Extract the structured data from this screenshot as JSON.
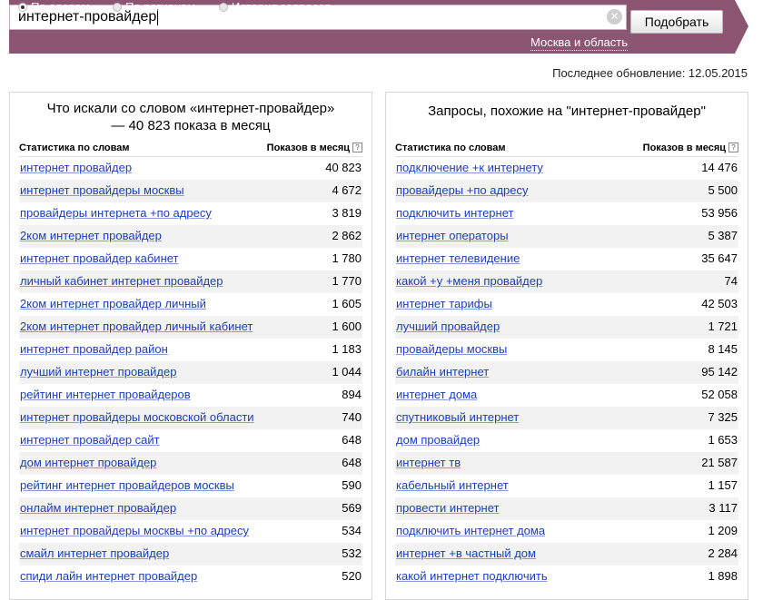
{
  "search": {
    "query": "интернет-провайдер",
    "submit_label": "Подобрать",
    "modes": [
      {
        "label": "По словам",
        "checked": true
      },
      {
        "label": "По регионам",
        "checked": false
      },
      {
        "label": "История запросов",
        "checked": false
      }
    ],
    "region": "Москва и область"
  },
  "last_updated": "Последнее обновление: 12.05.2015",
  "colors": {
    "header_bg": "#8c5672",
    "link": "#1a3dc1"
  },
  "left_panel": {
    "title": "Что искали со словом «интернет-провайдер» — 40 823 показа в месяц",
    "col_phrase": "Статистика по словам",
    "col_count": "Показов в месяц",
    "rows": [
      {
        "phrase": "интернет провайдер",
        "count": "40 823"
      },
      {
        "phrase": "интернет провайдеры москвы",
        "count": "4 672"
      },
      {
        "phrase": "провайдеры интернета +по адресу",
        "count": "3 819"
      },
      {
        "phrase": "2ком интернет провайдер",
        "count": "2 862"
      },
      {
        "phrase": "интернет провайдер кабинет",
        "count": "1 780"
      },
      {
        "phrase": "личный кабинет интернет провайдер",
        "count": "1 770"
      },
      {
        "phrase": "2ком интернет провайдер личный",
        "count": "1 605"
      },
      {
        "phrase": "2ком интернет провайдер личный кабинет",
        "count": "1 600"
      },
      {
        "phrase": "интернет провайдер район",
        "count": "1 183"
      },
      {
        "phrase": "лучший интернет провайдер",
        "count": "1 044"
      },
      {
        "phrase": "рейтинг интернет провайдеров",
        "count": "894"
      },
      {
        "phrase": "интернет провайдеры московской области",
        "count": "740"
      },
      {
        "phrase": "интернет провайдер сайт",
        "count": "648"
      },
      {
        "phrase": "дом интернет провайдер",
        "count": "648"
      },
      {
        "phrase": "рейтинг интернет провайдеров москвы",
        "count": "590"
      },
      {
        "phrase": "онлайм интернет провайдер",
        "count": "569"
      },
      {
        "phrase": "интернет провайдеры москвы +по адресу",
        "count": "534"
      },
      {
        "phrase": "смайл интернет провайдер",
        "count": "532"
      },
      {
        "phrase": "спиди лайн интернет провайдер",
        "count": "520"
      }
    ]
  },
  "right_panel": {
    "title": "Запросы, похожие на \"интернет-провайдер\"",
    "col_phrase": "Статистика по словам",
    "col_count": "Показов в месяц",
    "rows": [
      {
        "phrase": "подключение +к интернету",
        "count": "14 476"
      },
      {
        "phrase": "провайдеры +по адресу",
        "count": "5 500"
      },
      {
        "phrase": "подключить интернет",
        "count": "53 956"
      },
      {
        "phrase": "интернет операторы",
        "count": "5 387"
      },
      {
        "phrase": "интернет телевидение",
        "count": "35 647"
      },
      {
        "phrase": "какой +у +меня провайдер",
        "count": "74"
      },
      {
        "phrase": "интернет тарифы",
        "count": "42 503"
      },
      {
        "phrase": "лучший провайдер",
        "count": "1 721"
      },
      {
        "phrase": "провайдеры москвы",
        "count": "8 145"
      },
      {
        "phrase": "билайн интернет",
        "count": "95 142"
      },
      {
        "phrase": "интернет дома",
        "count": "52 058"
      },
      {
        "phrase": "спутниковый интернет",
        "count": "7 325"
      },
      {
        "phrase": "дом провайдер",
        "count": "1 653"
      },
      {
        "phrase": "интернет тв",
        "count": "21 587"
      },
      {
        "phrase": "кабельный интернет",
        "count": "1 157"
      },
      {
        "phrase": "провести интернет",
        "count": "3 117"
      },
      {
        "phrase": "подключить интернет дома",
        "count": "1 209"
      },
      {
        "phrase": "интернет +в частный дом",
        "count": "2 284"
      },
      {
        "phrase": "какой интернет подключить",
        "count": "1 898"
      }
    ]
  }
}
